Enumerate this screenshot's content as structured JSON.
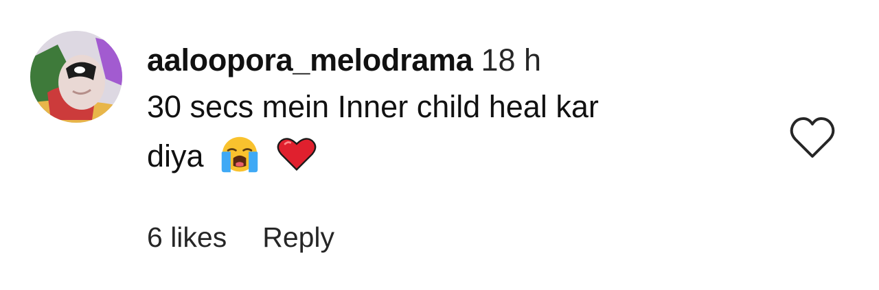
{
  "comment": {
    "username": "aaloopora_melodrama",
    "time": "18 h",
    "text_line1": "30 secs mein Inner child heal kar",
    "text_line2": "diya",
    "emojis": [
      "loudly-crying-face-emoji",
      "red-heart-emoji"
    ],
    "likes": "6 likes",
    "reply": "Reply",
    "like_icon": "heart-outline-icon"
  },
  "colors": {
    "text": "#111111",
    "secondary_text": "#262626",
    "emoji_heart": "#e0202e",
    "emoji_face": "#f9c22e",
    "emoji_tears": "#3fa9f5"
  }
}
